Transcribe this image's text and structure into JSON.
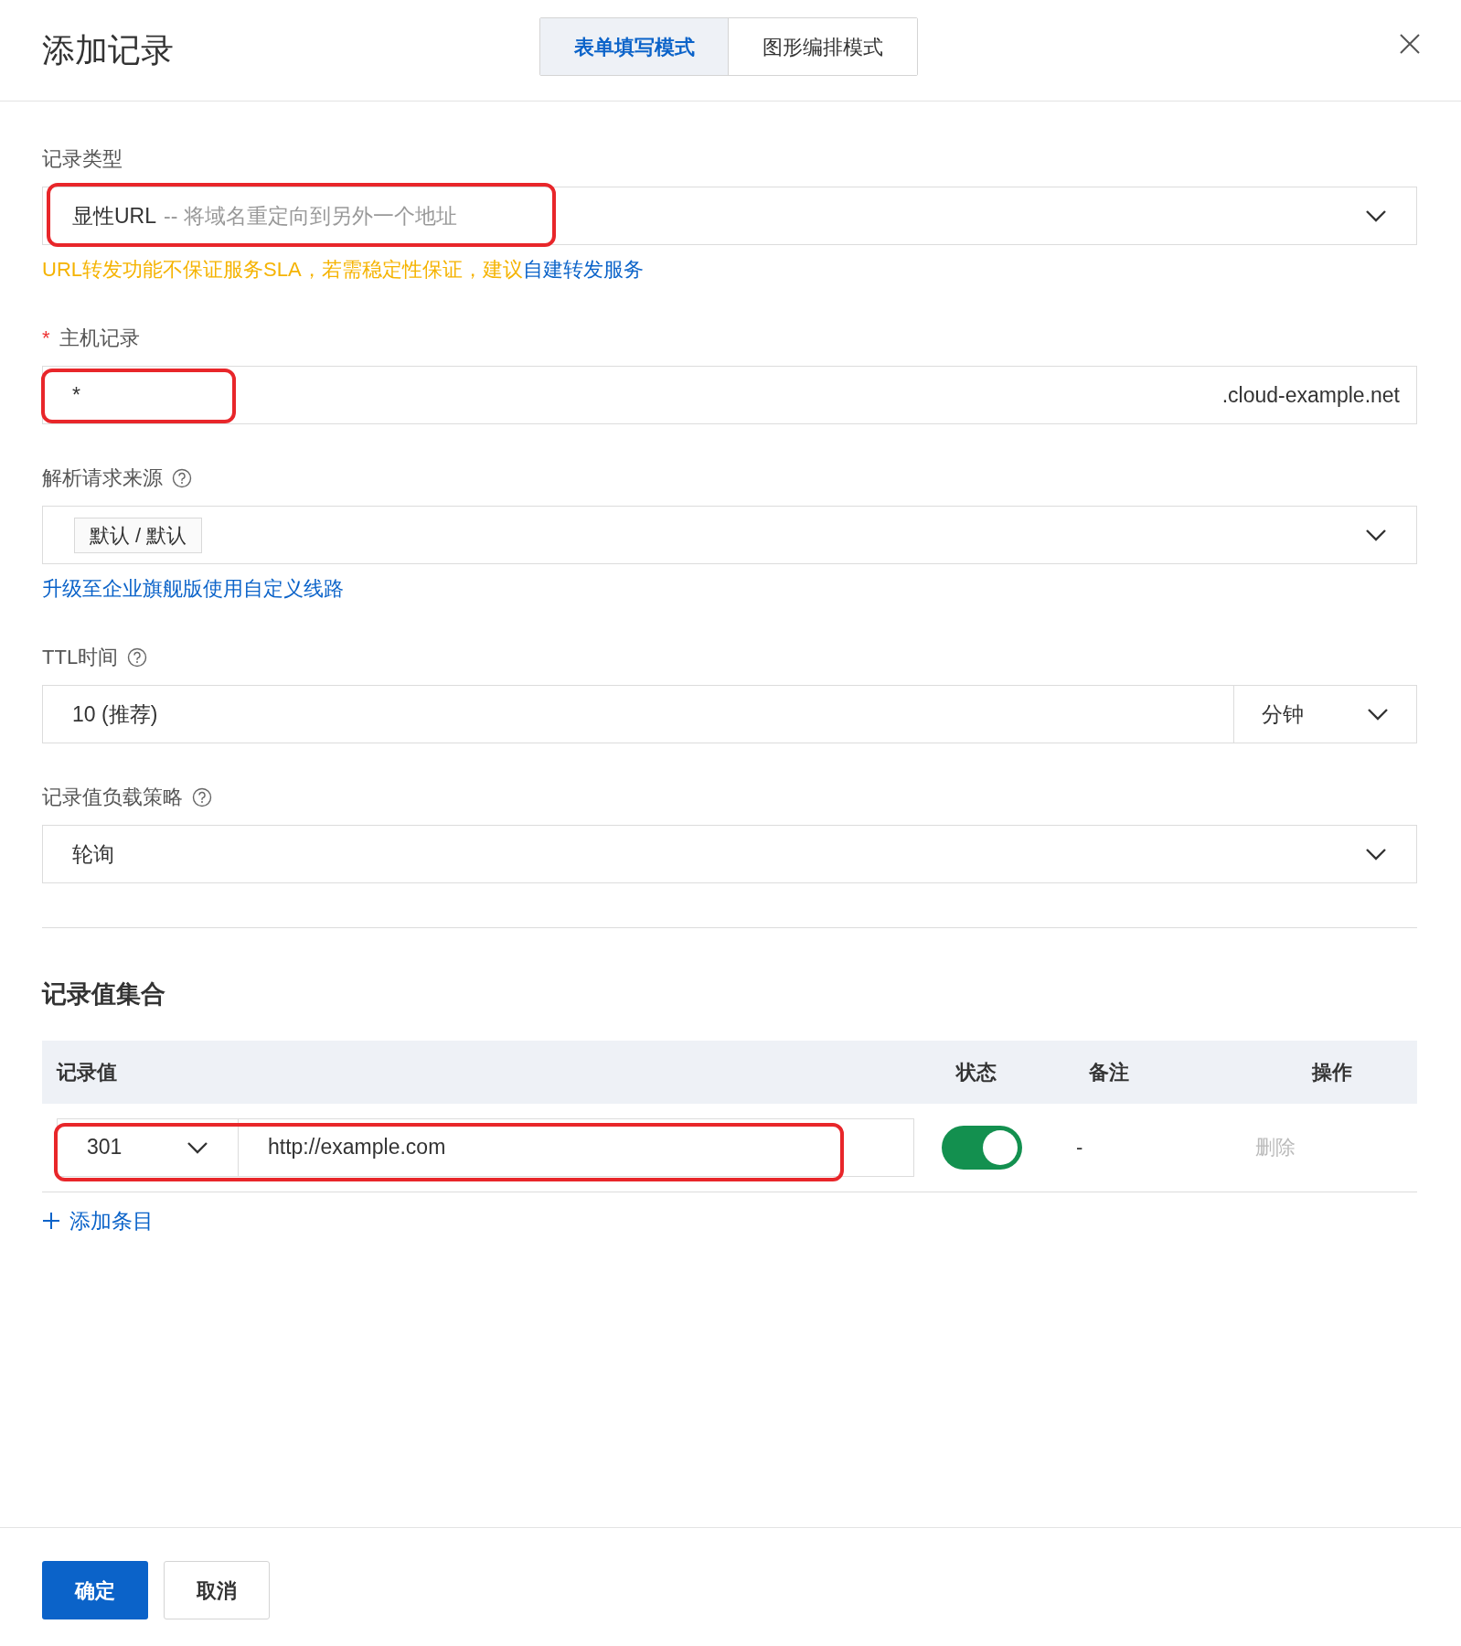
{
  "dialog": {
    "title": "添加记录"
  },
  "mode_tabs": [
    {
      "label": "表单填写模式",
      "selected": true
    },
    {
      "label": "图形编排模式",
      "selected": false
    }
  ],
  "record_type": {
    "label": "记录类型",
    "value": "显性URL",
    "hint": "-- 将域名重定向到另外一个地址",
    "highlighted": true,
    "warning": "URL转发功能不保证服务SLA，若需稳定性保证，建议",
    "warning_link": "自建转发服务"
  },
  "host": {
    "label": "主机记录",
    "required": true,
    "value": "*",
    "suffix": ".cloud-example.net",
    "highlighted": true
  },
  "source": {
    "label": "解析请求来源",
    "tags": [
      "默认 / 默认"
    ],
    "link": "升级至企业旗舰版使用自定义线路"
  },
  "ttl": {
    "label": "TTL时间",
    "value": "10 (推荐)",
    "unit": "分钟"
  },
  "strategy": {
    "label": "记录值负载策略",
    "value": "轮询"
  },
  "records": {
    "title": "记录值集合",
    "columns": [
      "记录值",
      "状态",
      "备注",
      "操作"
    ],
    "rows": [
      {
        "code": "301",
        "url": "http://example.com",
        "on": true,
        "note": "-",
        "action": "删除",
        "action_disabled": true,
        "highlighted": true
      }
    ],
    "add": "添加条目"
  },
  "buttons": [
    {
      "label": "确定",
      "kind": "primary"
    },
    {
      "label": "取消",
      "kind": "secondary"
    }
  ]
}
